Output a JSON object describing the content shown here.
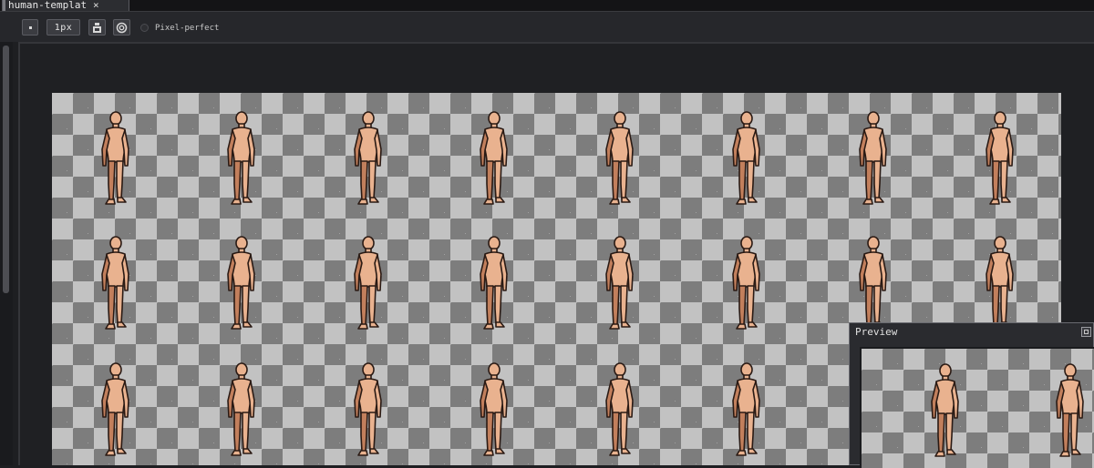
{
  "tab": {
    "title": "human-templat",
    "close_glyph": "×"
  },
  "toolbar": {
    "brush_size": "1px",
    "pixel_perfect_label": "Pixel-perfect",
    "icons": [
      "brush-dot-icon",
      "ink-bottle-icon",
      "spray-icon"
    ]
  },
  "preview": {
    "title": "Preview"
  },
  "colors": {
    "skin": "#e9b28f",
    "skin_shadow": "#c27f5c",
    "outline": "#2a1a14",
    "checker_light": "#c2c2c2",
    "checker_dark": "#7d7d7d",
    "ui_bg": "#1e1f22"
  }
}
